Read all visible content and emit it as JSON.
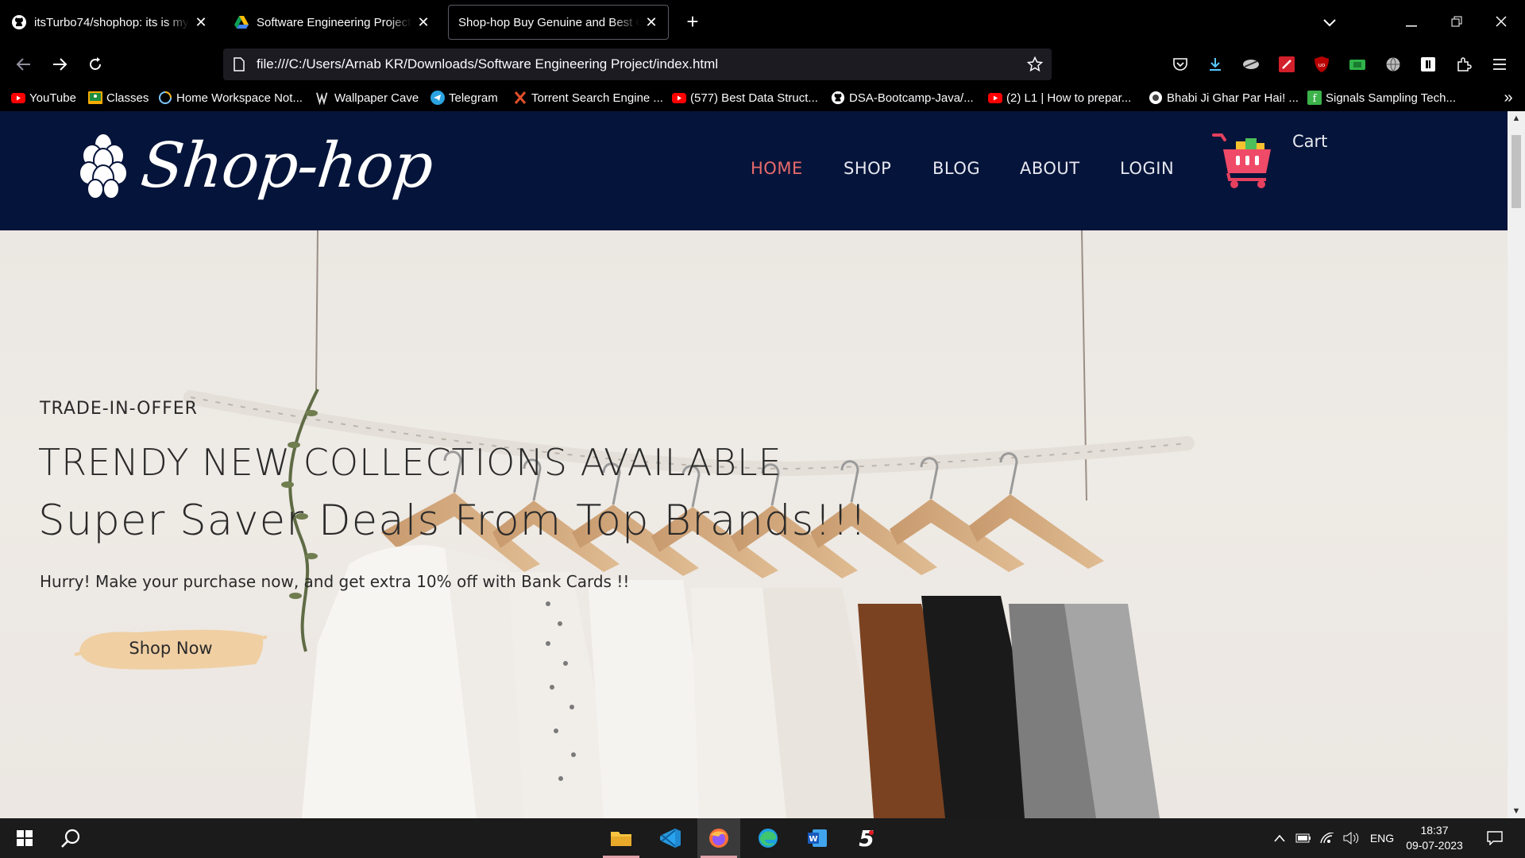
{
  "browser": {
    "tabs": [
      {
        "title": "itsTurbo74/shophop: its is my s",
        "icon": "github-icon"
      },
      {
        "title": "Software Engineering Project - G",
        "icon": "google-drive-icon"
      },
      {
        "title": "Shop-hop Buy Genuine and Best Cl",
        "icon": "none",
        "active": true
      }
    ],
    "url": "file:///C:/Users/Arnab KR/Downloads/Software Engineering Project/index.html",
    "bookmarks": [
      {
        "label": "YouTube",
        "icon": "youtube-icon"
      },
      {
        "label": "Classes",
        "icon": "classroom-icon"
      },
      {
        "label": "Home Workspace Not...",
        "icon": "workspace-icon"
      },
      {
        "label": "Wallpaper Cave",
        "icon": "wallpaper-cave-icon"
      },
      {
        "label": "Telegram",
        "icon": "telegram-icon"
      },
      {
        "label": "Torrent Search Engine ...",
        "icon": "torrent-icon"
      },
      {
        "label": "(577) Best Data Struct...",
        "icon": "youtube-icon"
      },
      {
        "label": "DSA-Bootcamp-Java/...",
        "icon": "github-icon"
      },
      {
        "label": "(2) L1 | How to prepar...",
        "icon": "youtube-icon"
      },
      {
        "label": "Bhabi Ji Ghar Par Hai! ...",
        "icon": "site-icon"
      },
      {
        "label": "Signals Sampling Tech...",
        "icon": "site-icon"
      }
    ]
  },
  "site": {
    "brand": "Shop-hop",
    "menu": [
      {
        "label": "HOME",
        "current": true
      },
      {
        "label": "SHOP"
      },
      {
        "label": "BLOG"
      },
      {
        "label": "ABOUT"
      },
      {
        "label": "LOGIN"
      }
    ],
    "cart_label": "Cart",
    "hero": {
      "eyebrow": "TRADE-IN-OFFER",
      "headline": "TRENDY NEW COLLECTIONS AVAILABLE",
      "subhead": "Super Saver Deals From Top Brands!!!",
      "blurb": "Hurry! Make your purchase now, and get extra 10% off with Bank Cards !!",
      "cta": "Shop Now"
    }
  },
  "taskbar": {
    "language": "ENG",
    "time": "18:37",
    "date": "09-07-2023",
    "apps": [
      "file-explorer-icon",
      "vscode-icon",
      "firefox-icon",
      "edge-icon",
      "word-icon",
      "channel-5-icon"
    ]
  },
  "colors": {
    "site_header_bg": "#05143a",
    "menu_active": "#e86b6b",
    "cta_brush": "#f0cfa3"
  }
}
